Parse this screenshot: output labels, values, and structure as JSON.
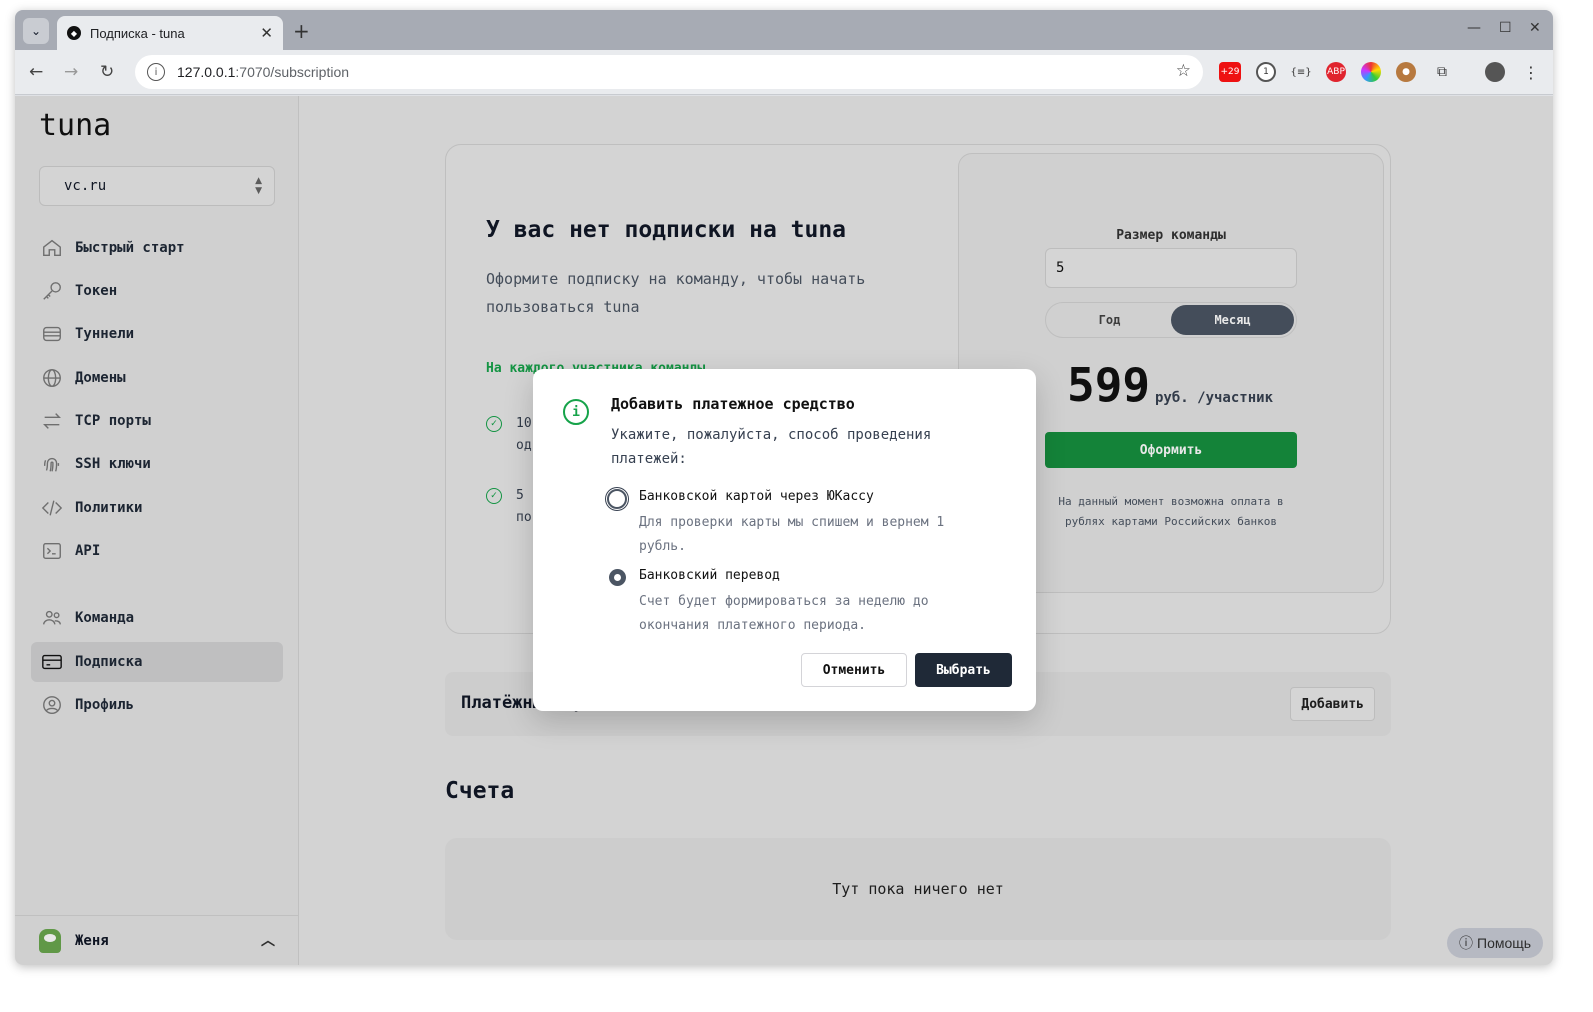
{
  "browser": {
    "tab_title": "Подписка - tuna",
    "url_host": "127.0.0.1",
    "url_path": ":7070/subscription",
    "extension_badge": "+29"
  },
  "sidebar": {
    "logo": "tuna",
    "org": "vc.ru",
    "items": [
      {
        "label": "Быстрый старт",
        "icon": "home-icon"
      },
      {
        "label": "Токен",
        "icon": "key-icon"
      },
      {
        "label": "Туннели",
        "icon": "tunnel-icon"
      },
      {
        "label": "Домены",
        "icon": "globe-icon"
      },
      {
        "label": "TCP порты",
        "icon": "arrows-icon"
      },
      {
        "label": "SSH ключи",
        "icon": "fingerprint-icon"
      },
      {
        "label": "Политики",
        "icon": "code-icon"
      },
      {
        "label": "API",
        "icon": "terminal-icon"
      },
      {
        "label": "Команда",
        "icon": "users-icon"
      },
      {
        "label": "Подписка",
        "icon": "card-icon"
      },
      {
        "label": "Профиль",
        "icon": "user-circle-icon"
      }
    ],
    "user": "Женя"
  },
  "subscription": {
    "title": "У вас нет подписки на tuna",
    "subtitle": "Оформите подписку на команду, чтобы начать пользоваться tuna",
    "features_heading": "На каждого участника команды",
    "features": [
      {
        "line1": "10",
        "line2": "од"
      },
      {
        "line1": "5",
        "line2": "по"
      }
    ],
    "team_size_label": "Размер команды",
    "team_size_value": "5",
    "period_options": [
      "Год",
      "Месяц"
    ],
    "period_selected": "Месяц",
    "price": "599",
    "price_unit": "руб. /участник",
    "cta": "Оформить",
    "note": "На данный момент возможна оплата в рублях картами Российских банков"
  },
  "payment_methods": {
    "title": "Платёжные средства",
    "add": "Добавить"
  },
  "invoices": {
    "title": "Счета",
    "empty": "Тут пока ничего нет"
  },
  "help": "Помощь",
  "modal": {
    "title": "Добавить платежное средство",
    "description": "Укажите, пожалуйста, способ проведения платежей:",
    "options": [
      {
        "label": "Банковской картой через ЮКассу",
        "description": "Для проверки карты мы спишем и вернем 1 рубль.",
        "selected": false
      },
      {
        "label": "Банковский перевод",
        "description": "Счет будет формироваться за неделю до окончания платежного периода.",
        "selected": true
      }
    ],
    "cancel": "Отменить",
    "confirm": "Выбрать"
  },
  "colors": {
    "accent_green": "#16913f",
    "dark": "#1f2937"
  }
}
